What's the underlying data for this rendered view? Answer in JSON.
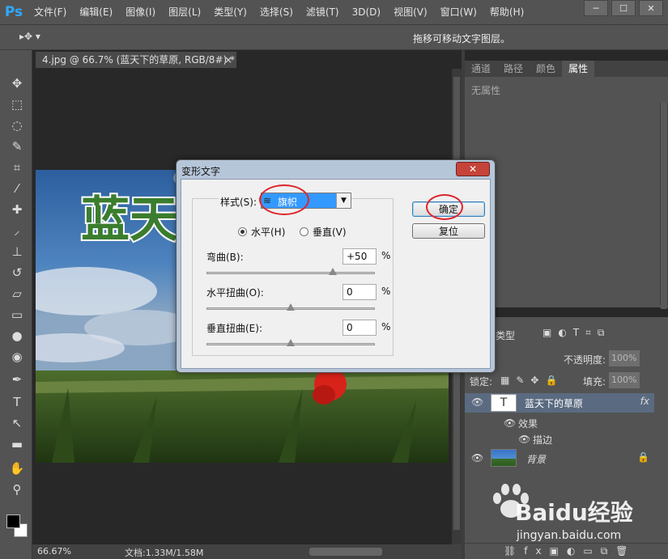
{
  "app": {
    "logo": "Ps",
    "brand_color": "#31a8ff"
  },
  "menu": [
    "文件(F)",
    "编辑(E)",
    "图像(I)",
    "图层(L)",
    "类型(Y)",
    "选择(S)",
    "滤镜(T)",
    "3D(D)",
    "视图(V)",
    "窗口(W)",
    "帮助(H)"
  ],
  "window_controls": [
    "minimize-icon",
    "maximize-icon",
    "close-icon"
  ],
  "options_bar": {
    "tool_icon": "move-tool-icon",
    "hint": "拖移可移动文字图层。"
  },
  "document": {
    "tab_title": "4.jpg @ 66.7% (蓝天下的草原, RGB/8#) *",
    "close": "×",
    "canvas_text": "蓝天下",
    "zoom": "66.67%",
    "doc_size": "文档:1.33M/1.58M"
  },
  "panels": {
    "tabs": [
      "通道",
      "路径",
      "颜色",
      "属性"
    ],
    "active_tab": "属性",
    "properties_empty": "无属性"
  },
  "layers": {
    "kind_label": "类型",
    "opacity_label": "不透明度:",
    "opacity_value": "100%",
    "lock_label": "锁定:",
    "fill_label": "填充:",
    "fill_value": "100%",
    "items": [
      {
        "name": "蓝天下的草原",
        "type": "text",
        "thumb_glyph": "T",
        "fx": "fx",
        "selected": true
      },
      {
        "name": "效果"
      },
      {
        "name": "描边"
      },
      {
        "name": "背景",
        "locked": true
      }
    ]
  },
  "dialog": {
    "title": "变形文字",
    "close_glyph": "✕",
    "style_label": "样式(S):",
    "style_icon": "flag-warp-icon",
    "style_value": "旗帜",
    "orientation": {
      "horizontal": "水平(H)",
      "vertical": "垂直(V)",
      "selected": "horizontal"
    },
    "bend": {
      "label": "弯曲(B):",
      "value": "+50",
      "unit": "%",
      "level": 0.75
    },
    "h_distortion": {
      "label": "水平扭曲(O):",
      "value": "0",
      "unit": "%",
      "level": 0.5
    },
    "v_distortion": {
      "label": "垂直扭曲(E):",
      "value": "0",
      "unit": "%",
      "level": 0.5
    },
    "ok_label": "确定",
    "reset_label": "复位",
    "annotation_color": "#e0242c"
  },
  "watermark": {
    "brand": "Baidu经验",
    "url": "jingyan.baidu.com"
  }
}
